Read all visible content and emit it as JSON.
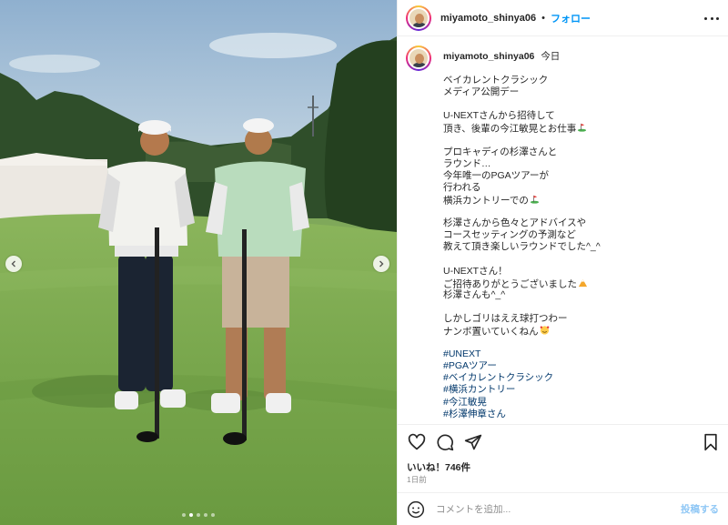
{
  "header": {
    "username": "miyamoto_shinya06",
    "separator": "•",
    "follow_label": "フォロー"
  },
  "caption": {
    "username": "miyamoto_shinya06",
    "date": "今日",
    "lines": [
      {
        "text": "ベイカレントクラシック",
        "type": "text"
      },
      {
        "text": "メディア公開デー",
        "type": "text"
      },
      {
        "text": "",
        "type": "blank"
      },
      {
        "text": "U-NEXTさんから招待して",
        "type": "text"
      },
      {
        "text": "頂き、後輩の今江敏晃とお仕事",
        "type": "text",
        "emoji": "golf-flag"
      },
      {
        "text": "",
        "type": "blank"
      },
      {
        "text": "プロキャディの杉澤さんと",
        "type": "text"
      },
      {
        "text": "ラウンド…",
        "type": "text"
      },
      {
        "text": "今年唯一のPGAツアーが",
        "type": "text"
      },
      {
        "text": "行われる",
        "type": "text"
      },
      {
        "text": "横浜カントリーでの",
        "type": "text",
        "emoji": "golf-flag"
      },
      {
        "text": "",
        "type": "blank"
      },
      {
        "text": "杉澤さんから色々とアドバイスや",
        "type": "text"
      },
      {
        "text": "コースセッティングの予測など",
        "type": "text"
      },
      {
        "text": "教えて頂き楽しいラウンドでした^_^",
        "type": "text"
      },
      {
        "text": "",
        "type": "blank"
      },
      {
        "text": "U-NEXTさん！",
        "type": "text"
      },
      {
        "text": "ご招待ありがとうございました",
        "type": "text",
        "emoji": "mountain"
      },
      {
        "text": "杉澤さんも^_^",
        "type": "text"
      },
      {
        "text": "",
        "type": "blank"
      },
      {
        "text": "しかしゴリはええ球打つわー",
        "type": "text"
      },
      {
        "text": "ナンボ置いていくねん",
        "type": "text",
        "emoji": "smiling-face-hearts"
      },
      {
        "text": "",
        "type": "blank"
      },
      {
        "text": "#UNEXT",
        "type": "tag"
      },
      {
        "text": "#PGAツアー",
        "type": "tag"
      },
      {
        "text": "#ベイカレントクラシック",
        "type": "tag"
      },
      {
        "text": "#横浜カントリー",
        "type": "tag"
      },
      {
        "text": "#今江敏晃",
        "type": "tag"
      },
      {
        "text": "#杉澤伸章さん",
        "type": "tag"
      }
    ]
  },
  "actions": {
    "icons": [
      "heart-icon",
      "comment-icon",
      "share-icon",
      "bookmark-icon"
    ]
  },
  "likes": "いいね！746件",
  "time": "1日前",
  "comment": {
    "placeholder": "コメントを追加...",
    "post_label": "投稿する"
  },
  "media": {
    "slide_count": 5,
    "active_slide": 1
  },
  "colors": {
    "accent": "#0095f6",
    "hashtag": "#00376b",
    "post_disabled": "#8fc7f5"
  }
}
